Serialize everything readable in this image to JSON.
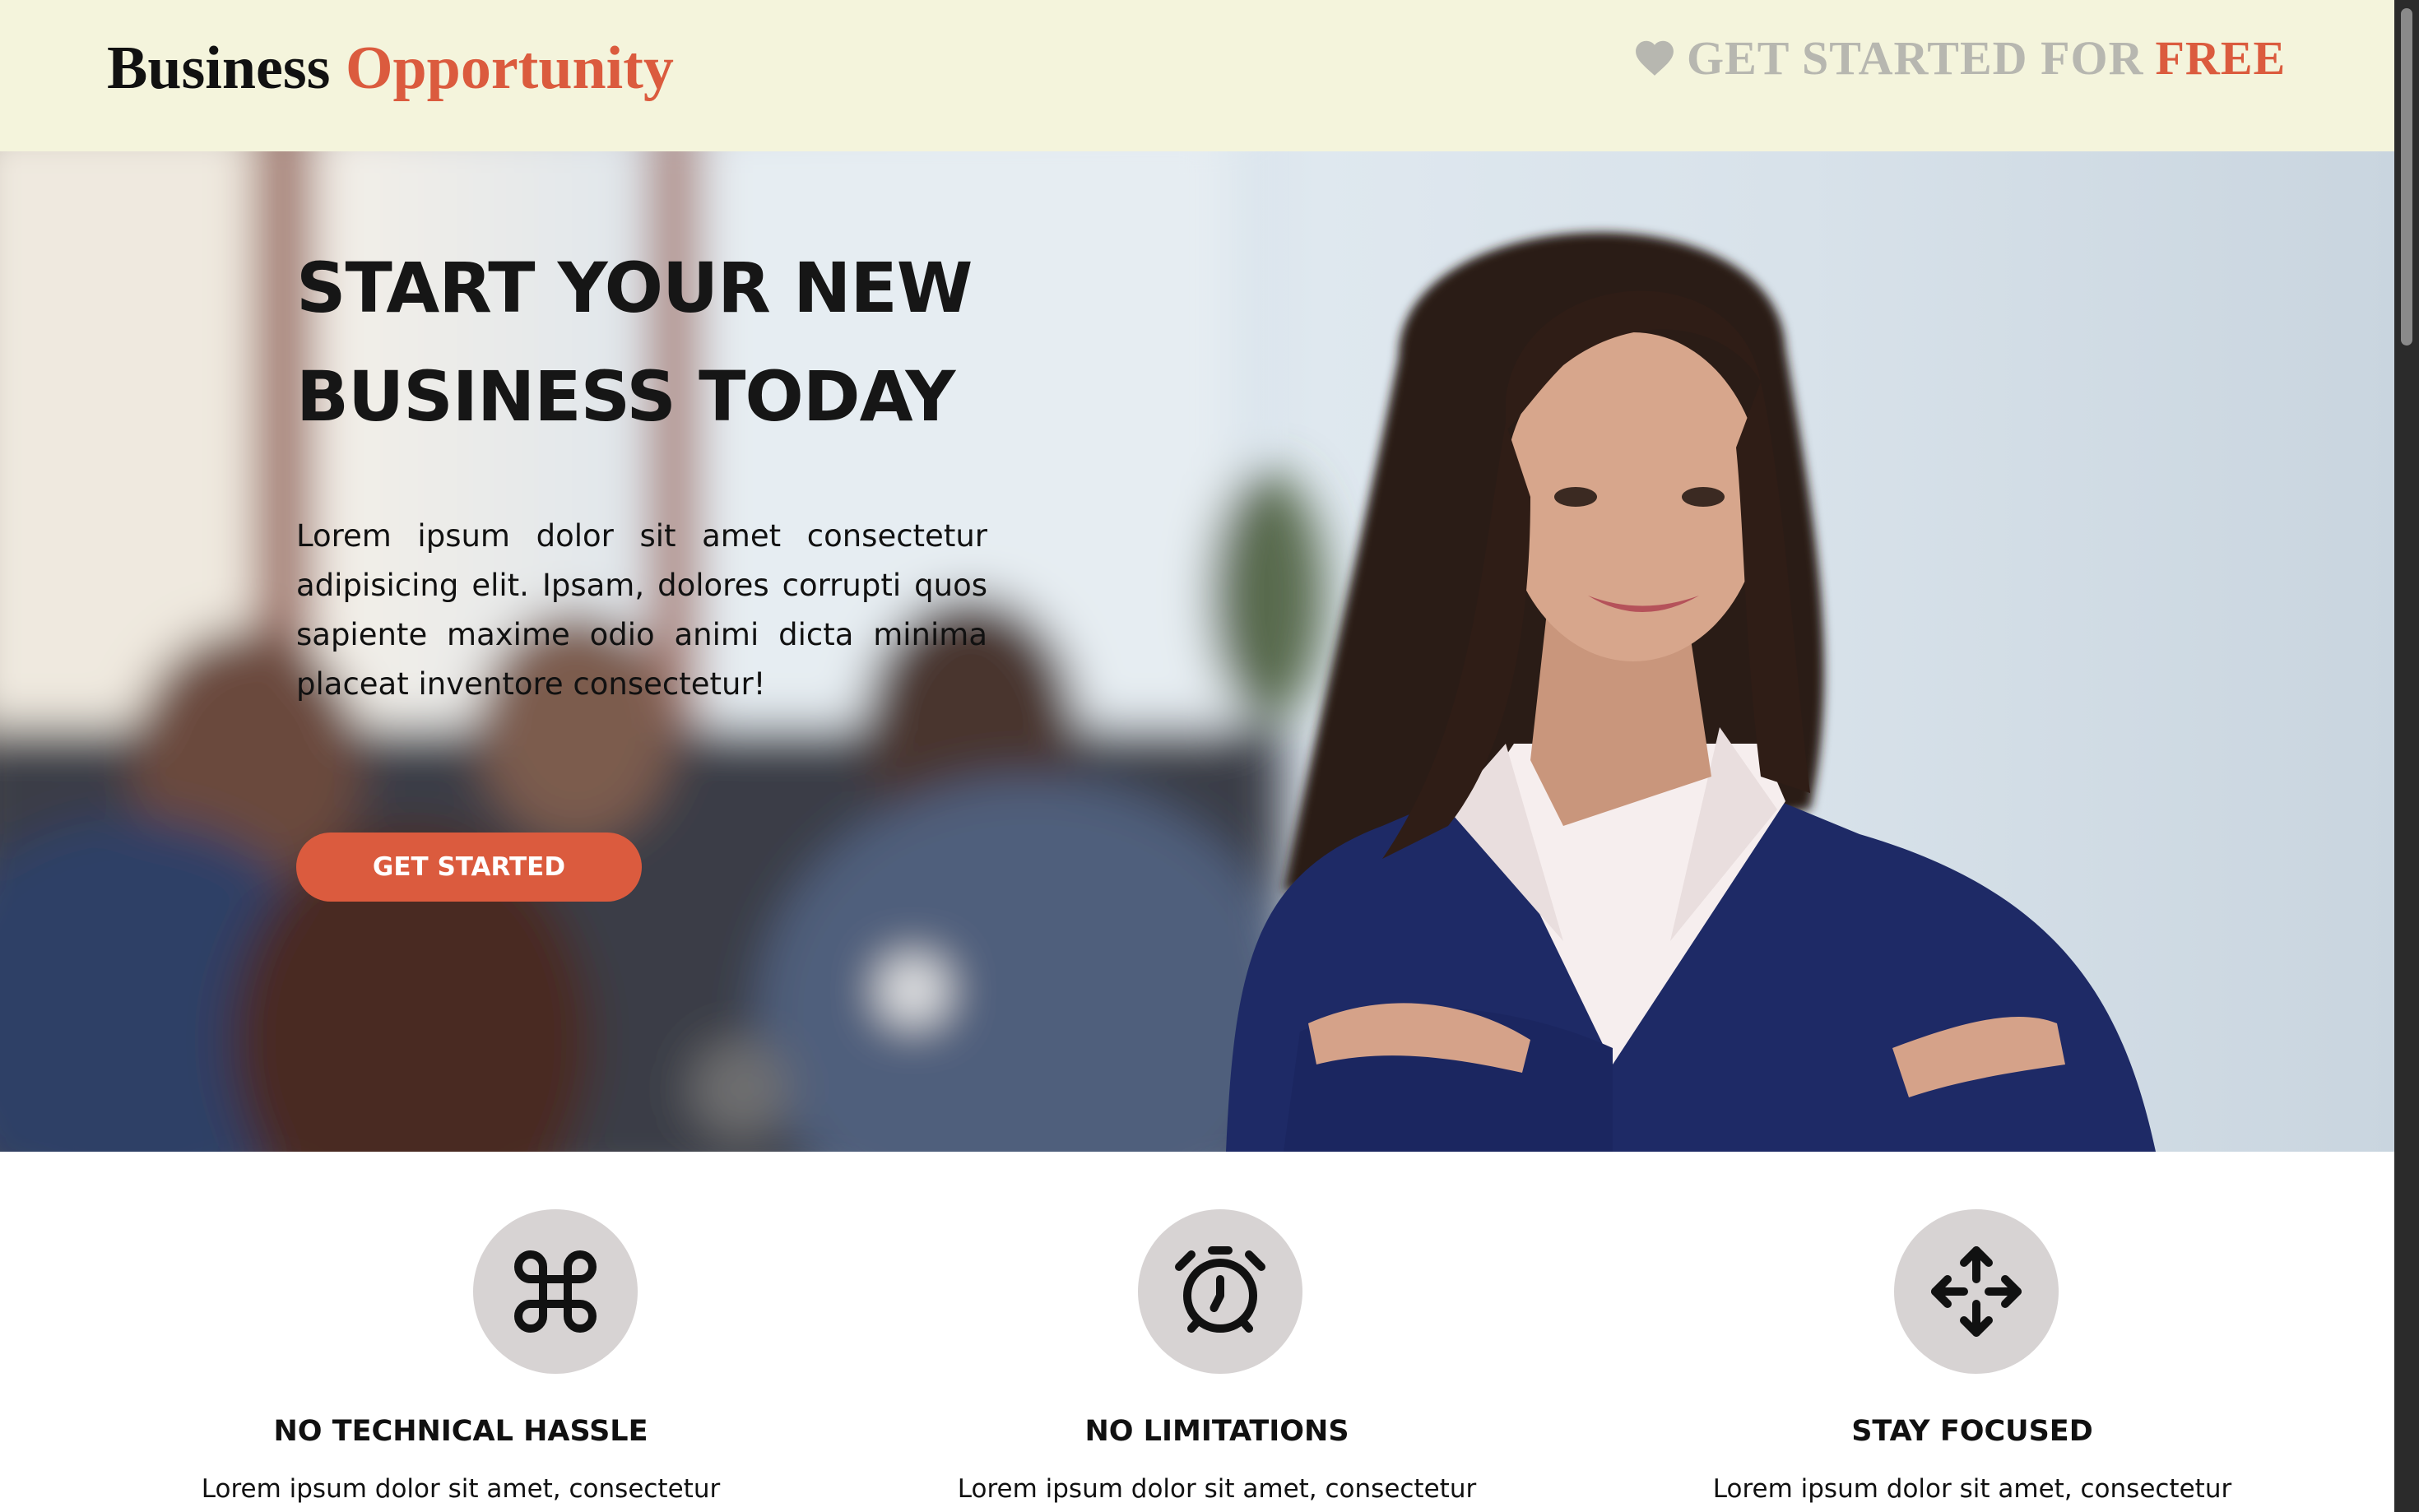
{
  "header": {
    "logo_word_1": "Business",
    "logo_word_2": "Opportunity",
    "cta_text": "GET STARTED FOR",
    "cta_accent": "FREE",
    "cta_icon": "heart-icon"
  },
  "hero": {
    "title_line_1": "START YOUR NEW",
    "title_line_2": "BUSINESS TODAY",
    "text": "Lorem ipsum dolor sit amet consectetur adipisicing elit. Ipsam, dolores corrupti quos sapiente maxime odio animi dicta minima placeat inventore consectetur!",
    "button_label": "GET STARTED"
  },
  "features": [
    {
      "icon": "command-icon",
      "title": "NO TECHNICAL HASSLE",
      "text": "Lorem ipsum dolor sit amet, consectetur"
    },
    {
      "icon": "alarm-clock-icon",
      "title": "NO LIMITATIONS",
      "text": "Lorem ipsum dolor sit amet, consectetur"
    },
    {
      "icon": "move-arrows-icon",
      "title": "STAY FOCUSED",
      "text": "Lorem ipsum dolor sit amet, consectetur"
    }
  ],
  "colors": {
    "accent": "#db5b3e",
    "header_bg": "#f4f4dc",
    "icon_circle": "#d7d3d3",
    "cta_gray": "#b7b7b0"
  }
}
